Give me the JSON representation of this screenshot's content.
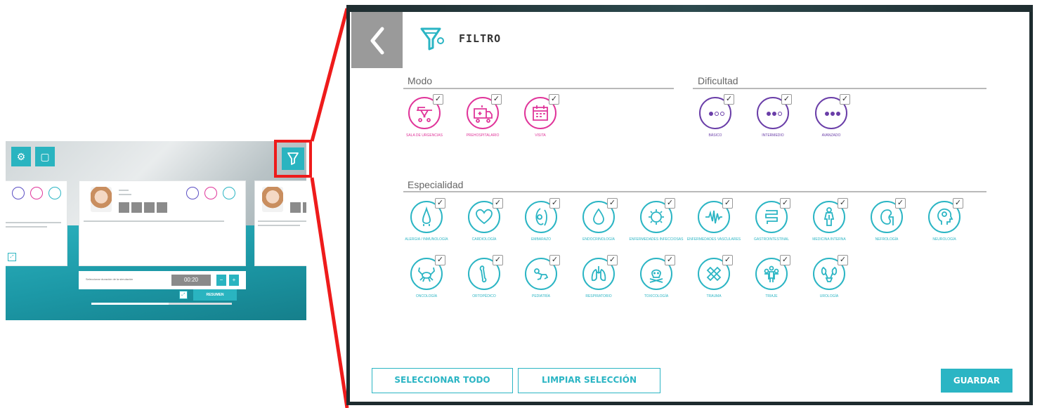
{
  "thumbnail": {
    "resumen_label": "RESUMEN",
    "duration_label": "Seleccionar duración de la simulación",
    "duration_value": "00:20",
    "minus_label": "−",
    "plus_label": "+",
    "progress": 0.55
  },
  "filter": {
    "title": "FILTRO",
    "modo": {
      "label": "Modo",
      "options": [
        {
          "label": "SALA DE URGENCIAS",
          "icon": "ambulance-stretcher-icon",
          "checked": true
        },
        {
          "label": "PREHOSPITALARIO",
          "icon": "ambulance-icon",
          "checked": true
        },
        {
          "label": "VISITA",
          "icon": "calendar-icon",
          "checked": true
        }
      ]
    },
    "dificultad": {
      "label": "Dificultad",
      "options": [
        {
          "label": "BÁSICO",
          "level": 1,
          "checked": true
        },
        {
          "label": "INTERMEDIO",
          "level": 2,
          "checked": true
        },
        {
          "label": "AVANZADO",
          "level": 3,
          "checked": true
        }
      ]
    },
    "especialidad": {
      "label": "Especialidad",
      "options": [
        {
          "label": "ALERGIA / INMUNOLOGÍA",
          "icon": "nose-icon",
          "checked": true
        },
        {
          "label": "CARDIOLOGÍA",
          "icon": "heart-icon",
          "checked": true
        },
        {
          "label": "EMBARAZO",
          "icon": "pregnancy-icon",
          "checked": true
        },
        {
          "label": "ENDOCRINOLOGÍA",
          "icon": "drop-icon",
          "checked": true
        },
        {
          "label": "ENFERMEDADES INFECCIOSAS",
          "icon": "virus-icon",
          "checked": true
        },
        {
          "label": "ENFERMEDADES VASCULARES",
          "icon": "vessels-icon",
          "checked": true
        },
        {
          "label": "GASTROINTESTINAL",
          "icon": "intestine-icon",
          "checked": true
        },
        {
          "label": "MEDICINA INTERNA",
          "icon": "body-icon",
          "checked": true
        },
        {
          "label": "NEFROLOGÍA",
          "icon": "kidney-icon",
          "checked": true
        },
        {
          "label": "NEUROLOGÍA",
          "icon": "brain-head-icon",
          "checked": true
        },
        {
          "label": "ONCOLOGÍA",
          "icon": "crab-icon",
          "checked": true
        },
        {
          "label": "ORTOPÉDICO",
          "icon": "bone-icon",
          "checked": true
        },
        {
          "label": "PEDIATRÍA",
          "icon": "baby-icon",
          "checked": true
        },
        {
          "label": "RESPIRATORIO",
          "icon": "lungs-icon",
          "checked": true
        },
        {
          "label": "TOXICOLOGÍA",
          "icon": "skull-icon",
          "checked": true
        },
        {
          "label": "TRAUMA",
          "icon": "bandage-icon",
          "checked": true
        },
        {
          "label": "TRIAJE",
          "icon": "group-icon",
          "checked": true
        },
        {
          "label": "UROLOGÍA",
          "icon": "kidneys-bladder-icon",
          "checked": true
        }
      ]
    },
    "buttons": {
      "select_all": "SELECCIONAR TODO",
      "clear": "LIMPIAR SELECCIÓN",
      "save": "GUARDAR"
    }
  },
  "colors": {
    "teal": "#2bb5c4",
    "pink": "#e0359a",
    "purple": "#6a3ea8",
    "callout_red": "#ee1b1b"
  }
}
